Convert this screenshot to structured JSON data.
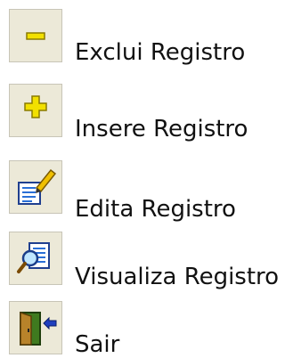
{
  "actions": [
    {
      "label": "Exclui Registro",
      "icon": "minus-icon"
    },
    {
      "label": "Insere Registro",
      "icon": "plus-icon"
    },
    {
      "label": "Edita Registro",
      "icon": "edit-document-icon"
    },
    {
      "label": "Visualiza Registro",
      "icon": "view-document-icon"
    },
    {
      "label": "Sair",
      "icon": "exit-door-icon"
    }
  ]
}
